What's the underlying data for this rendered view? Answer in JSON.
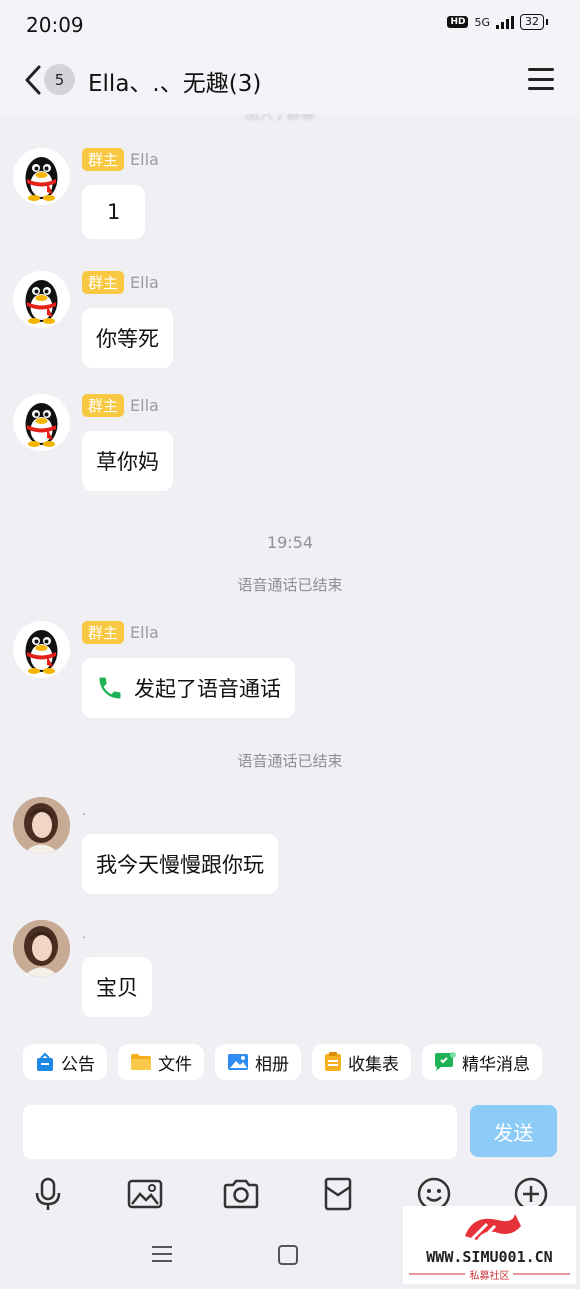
{
  "status": {
    "time": "20:09",
    "hd": "HD",
    "network": "5G",
    "battery": "32"
  },
  "header": {
    "badge": "5",
    "title": "Ella、.、无趣(3)"
  },
  "chat": {
    "faded_text": "加入了群聊",
    "messages": [
      {
        "role": "群主",
        "name": "Ella",
        "text": "1"
      },
      {
        "role": "群主",
        "name": "Ella",
        "text": "你等死"
      },
      {
        "role": "群主",
        "name": "Ella",
        "text": "草你妈"
      },
      {
        "role": "群主",
        "name": "Ella",
        "text": "发起了语音通话"
      },
      {
        "name": ".",
        "text": "我今天慢慢跟你玩"
      },
      {
        "name": ".",
        "text": "宝贝"
      }
    ],
    "timestamp": "19:54",
    "system_1": "语音通话已结束",
    "system_2": "语音通话已结束"
  },
  "toolbar": {
    "notice": "公告",
    "files": "文件",
    "album": "相册",
    "form": "收集表",
    "essence": "精华消息"
  },
  "input": {
    "value": "",
    "send_label": "发送"
  },
  "watermark": {
    "site": "WWW.SIMU001.CN",
    "sub": "私募社区"
  },
  "colors": {
    "accent": "#12b7f5",
    "role_badge": "#f8c842",
    "send_disabled": "#8ccbf5",
    "background": "#efeff4"
  }
}
